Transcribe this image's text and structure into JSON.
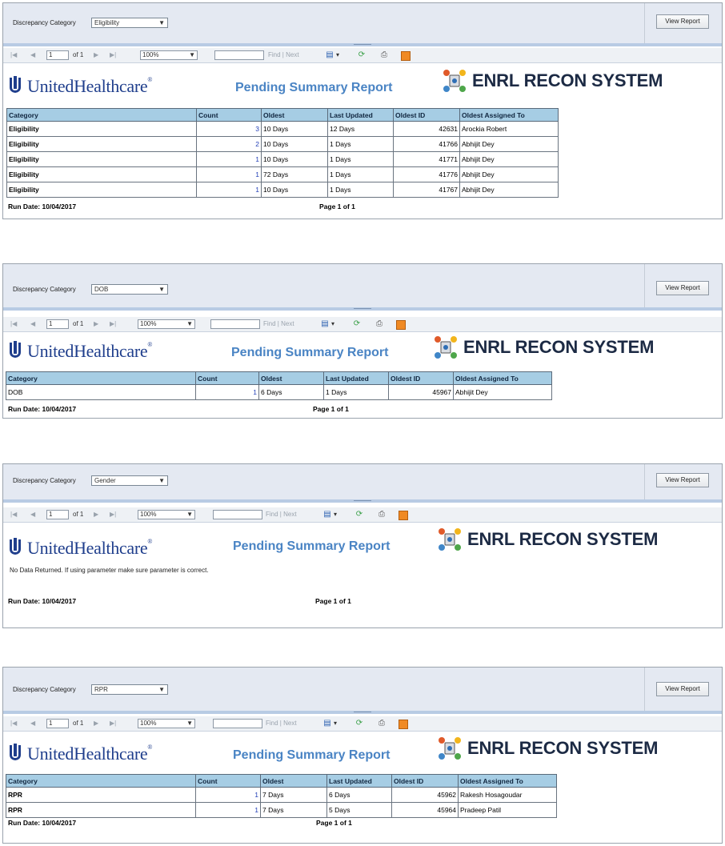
{
  "common": {
    "param_label": "Discrepancy Category",
    "view_report_label": "View Report",
    "toolbar": {
      "page_value": "1",
      "of_label": "of 1",
      "zoom": "100%",
      "find_label": "Find",
      "separator": "|",
      "next_label": "Next"
    },
    "brand": "UnitedHealthcare",
    "reg_mark": "®",
    "report_title": "Pending Summary Report",
    "system_name": "ENRL RECON SYSTEM",
    "columns": [
      "Category",
      "Count",
      "Oldest",
      "Last Updated",
      "Oldest ID",
      "Oldest Assigned To"
    ],
    "run_date": "Run Date: 10/04/2017",
    "page_info": "Page 1 of 1"
  },
  "panels": [
    {
      "category": "Eligibility",
      "rows": [
        [
          "Eligibility",
          "3",
          "10 Days",
          "12 Days",
          "42631",
          "Arockia Robert"
        ],
        [
          "Eligibility",
          "2",
          "10 Days",
          "1 Days",
          "41766",
          "Abhijit Dey"
        ],
        [
          "Eligibility",
          "1",
          "10 Days",
          "1 Days",
          "41771",
          "Abhijit Dey"
        ],
        [
          "Eligibility",
          "1",
          "72 Days",
          "1 Days",
          "41776",
          "Abhijit Dey"
        ],
        [
          "Eligibility",
          "1",
          "10 Days",
          "1 Days",
          "41767",
          "Abhijit Dey"
        ]
      ]
    },
    {
      "category": "DOB",
      "rows": [
        [
          "DOB",
          "1",
          "6 Days",
          "1 Days",
          "45967",
          "Abhijit Dey"
        ]
      ]
    },
    {
      "category": "Gender",
      "rows": [],
      "no_data": "No Data Returned. If using parameter make sure parameter is correct."
    },
    {
      "category": "RPR",
      "rows": [
        [
          "RPR",
          "1",
          "7 Days",
          "6 Days",
          "45962",
          "Rakesh Hosagoudar"
        ],
        [
          "RPR",
          "1",
          "7 Days",
          "5 Days",
          "45964",
          "Pradeep Patil"
        ]
      ]
    }
  ]
}
